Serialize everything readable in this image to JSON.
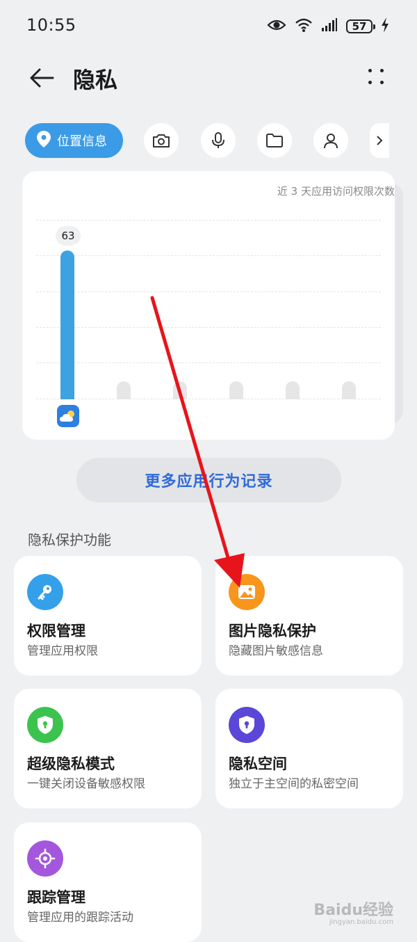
{
  "status_bar": {
    "time": "10:55",
    "battery": "57"
  },
  "header": {
    "title": "隐私"
  },
  "filters": {
    "active_label": "位置信息",
    "items": [
      "camera-icon",
      "microphone-icon",
      "folder-icon",
      "contacts-icon"
    ]
  },
  "chart_data": {
    "type": "bar",
    "title": "近 3 天应用访问权限次数",
    "categories": [
      "app-1",
      "app-2",
      "app-3",
      "app-4",
      "app-5",
      "app-6"
    ],
    "values": [
      63,
      0,
      0,
      0,
      0,
      0
    ],
    "data_labels": [
      "63"
    ],
    "colors": {
      "active": "#3da2e0",
      "placeholder": "#e6e6e6"
    }
  },
  "more_records": {
    "label": "更多应用行为记录"
  },
  "section": {
    "title": "隐私保护功能"
  },
  "features": [
    {
      "title": "权限管理",
      "subtitle": "管理应用权限",
      "icon": "key-icon",
      "color": "#35a0ea"
    },
    {
      "title": "图片隐私保护",
      "subtitle": "隐藏图片敏感信息",
      "icon": "image-icon",
      "color": "#f7951d"
    },
    {
      "title": "超级隐私模式",
      "subtitle": "一键关闭设备敏感权限",
      "icon": "shield-lock-icon",
      "color": "#3cc34e"
    },
    {
      "title": "隐私空间",
      "subtitle": "独立于主空间的私密空间",
      "icon": "shield-lock-icon",
      "color": "#5a47d8"
    },
    {
      "title": "跟踪管理",
      "subtitle": "管理应用的跟踪活动",
      "icon": "target-icon",
      "color": "#a457dd"
    }
  ],
  "watermark": {
    "text": "Baidu经验",
    "sub": "jingyan.baidu.com"
  }
}
